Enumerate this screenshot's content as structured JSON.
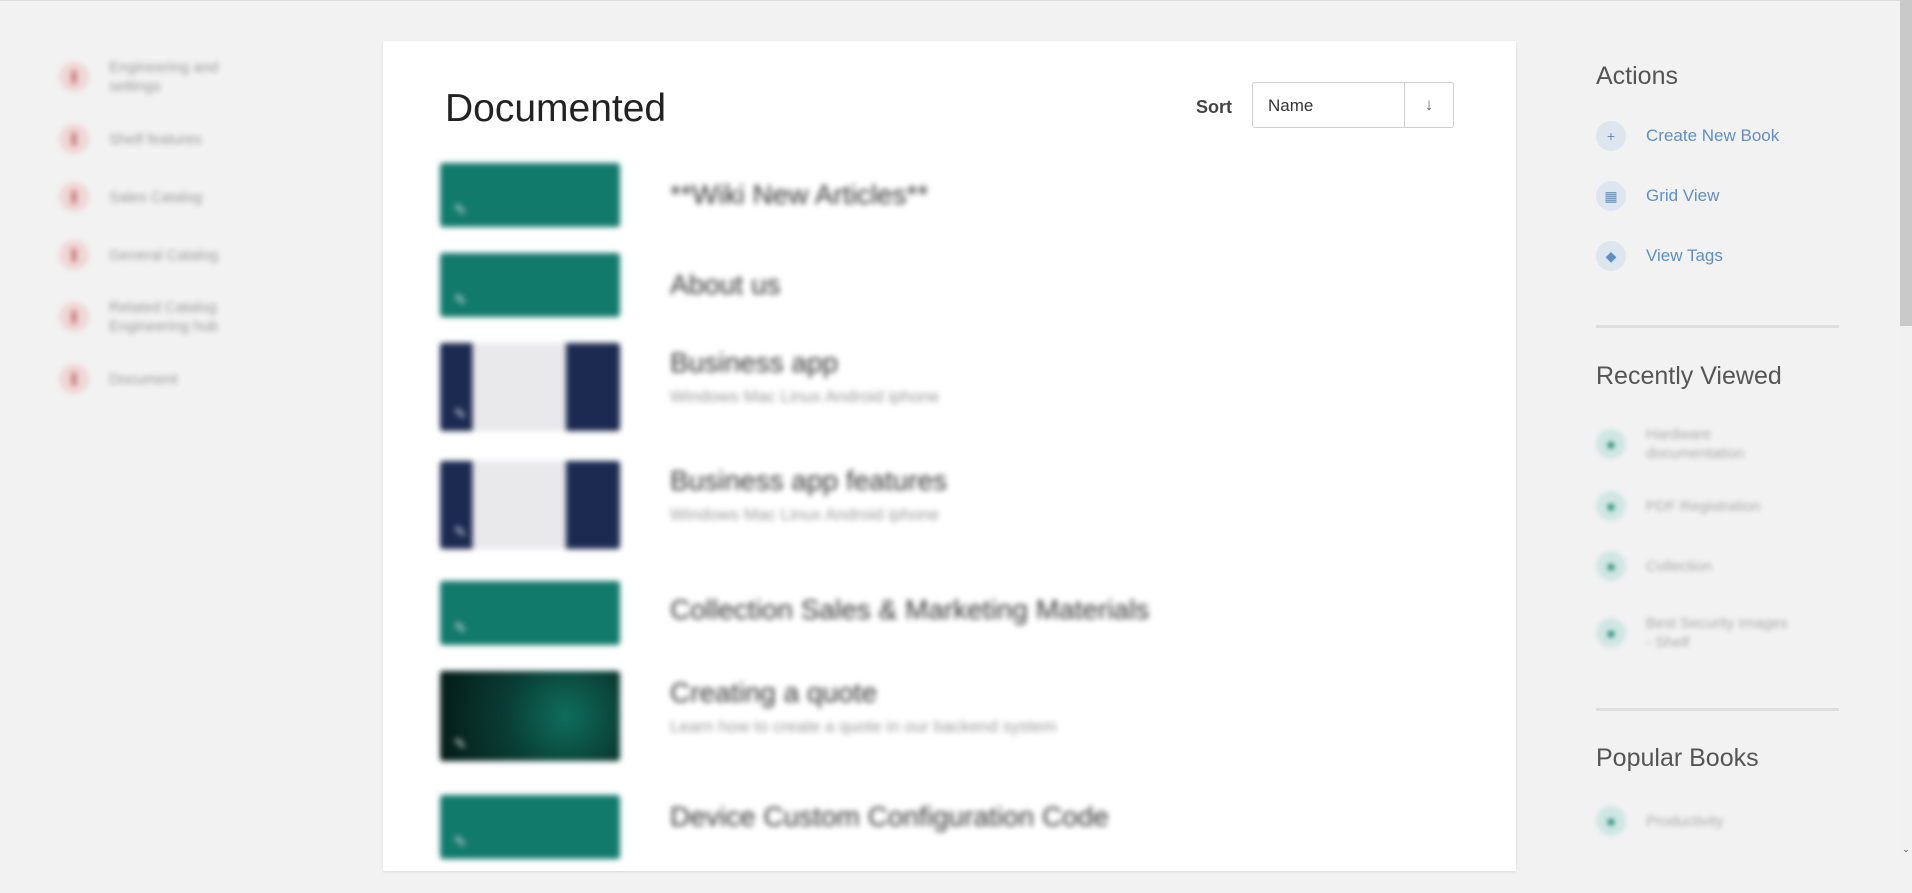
{
  "left_sidebar": {
    "items": [
      {
        "icon": "shelf-icon",
        "label": "Engineering and settings"
      },
      {
        "icon": "shelf-icon",
        "label": "Shelf features"
      },
      {
        "icon": "shelf-icon",
        "label": "Sales Catalog"
      },
      {
        "icon": "shelf-icon",
        "label": "General Catalog"
      },
      {
        "icon": "shelf-icon",
        "label": "Related Catalog Engineering hub"
      },
      {
        "icon": "shelf-icon",
        "label": "Document"
      }
    ]
  },
  "main": {
    "title": "Documented",
    "sort": {
      "label": "Sort",
      "value": "Name",
      "direction_icon": "arrow-down-icon"
    },
    "books": [
      {
        "name": "**Wiki New Articles**",
        "description": "",
        "thumb": "teal"
      },
      {
        "name": "About us",
        "description": "",
        "thumb": "teal"
      },
      {
        "name": "Business app",
        "description": "Windows Mac Linux Android iphone",
        "thumb": "dark"
      },
      {
        "name": "Business app features",
        "description": "Windows Mac Linux Android iphone",
        "thumb": "dark"
      },
      {
        "name": "Collection Sales & Marketing Materials",
        "description": "",
        "thumb": "teal"
      },
      {
        "name": "Creating a quote",
        "description": "Learn how to create a quote in our backend system",
        "thumb": "black"
      },
      {
        "name": "Device Custom Configuration Code",
        "description": "",
        "thumb": "teal"
      }
    ]
  },
  "right_sidebar": {
    "actions_title": "Actions",
    "actions": [
      {
        "icon": "plus-icon",
        "label": "Create New Book"
      },
      {
        "icon": "grid-icon",
        "label": "Grid View"
      },
      {
        "icon": "tag-icon",
        "label": "View Tags"
      }
    ],
    "recently_viewed_title": "Recently Viewed",
    "recently_viewed": [
      {
        "icon": "book-icon",
        "label": "Hardware documentation"
      },
      {
        "icon": "book-icon",
        "label": "PDF Registration"
      },
      {
        "icon": "book-icon",
        "label": "Collection"
      },
      {
        "icon": "book-icon",
        "label": "Best Security Images - Shelf"
      }
    ],
    "popular_title": "Popular Books",
    "popular": [
      {
        "icon": "book-icon",
        "label": "Productivity"
      }
    ]
  },
  "colors": {
    "accent": "#5f8fc0",
    "shelf": "#c46b6b",
    "book": "#2f8f80",
    "thumb_teal": "#127a6b",
    "background": "#f2f2f2"
  }
}
